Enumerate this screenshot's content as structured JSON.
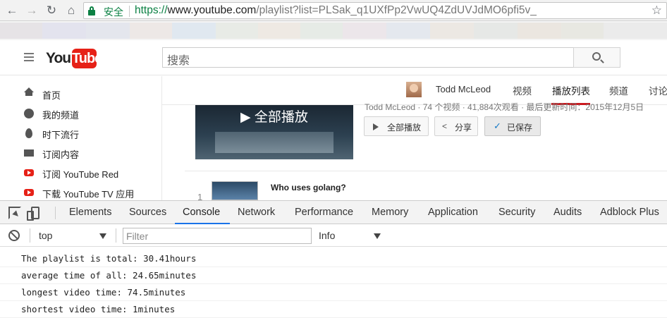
{
  "browser": {
    "secure_label": "安全",
    "url_protocol": "https://",
    "url_host": "www.youtube.com",
    "url_path": "/playlist?list=PLSak_q1UXfPp2VwUQ4ZdUVJdMO6pfi5v_",
    "back_icon": "←",
    "forward_icon": "→",
    "reload_icon": "↻",
    "home_icon": "⌂",
    "star_icon": "☆"
  },
  "youtube": {
    "logo_you": "You",
    "logo_tube": "Tube",
    "search_placeholder": "搜索",
    "sidebar": [
      {
        "label": "首页",
        "icon": "home-icon"
      },
      {
        "label": "我的频道",
        "icon": "channel-icon"
      },
      {
        "label": "时下流行",
        "icon": "trending-icon"
      },
      {
        "label": "订阅内容",
        "icon": "subscriptions-icon"
      },
      {
        "label": "订阅 YouTube Red",
        "icon": "youtube-red-icon"
      },
      {
        "label": "下载 YouTube TV 应用",
        "icon": "youtube-tv-icon"
      }
    ],
    "channel": {
      "owner": "Todd McLeod",
      "tabs": [
        "视频",
        "播放列表",
        "频道",
        "讨论"
      ],
      "active_tab": "播放列表"
    },
    "playlist": {
      "overlay_label": "▶ 全部播放",
      "meta": "Todd McLeod · 74 个视频 · 41,884次观看 · 最后更新时间：2015年12月5日",
      "play_all_button": "全部播放",
      "share_button": "分享",
      "saved_button": "已保存",
      "first_item_index": "1",
      "first_item_title": "Who uses golang?"
    }
  },
  "devtools": {
    "tabs": [
      "Elements",
      "Sources",
      "Console",
      "Network",
      "Performance",
      "Memory",
      "Application",
      "Security",
      "Audits",
      "Adblock Plus"
    ],
    "active_tab": "Console",
    "context": "top",
    "filter_placeholder": "Filter",
    "level": "Info",
    "logs": [
      "The playlist is total: 30.41hours",
      "average time of all: 24.65minutes",
      "longest video time: 74.5minutes",
      "shortest video time: 1minutes"
    ]
  },
  "colors": {
    "youtube_red": "#e62117",
    "secure_green": "#0b8043",
    "devtools_accent": "#1a73e8"
  }
}
